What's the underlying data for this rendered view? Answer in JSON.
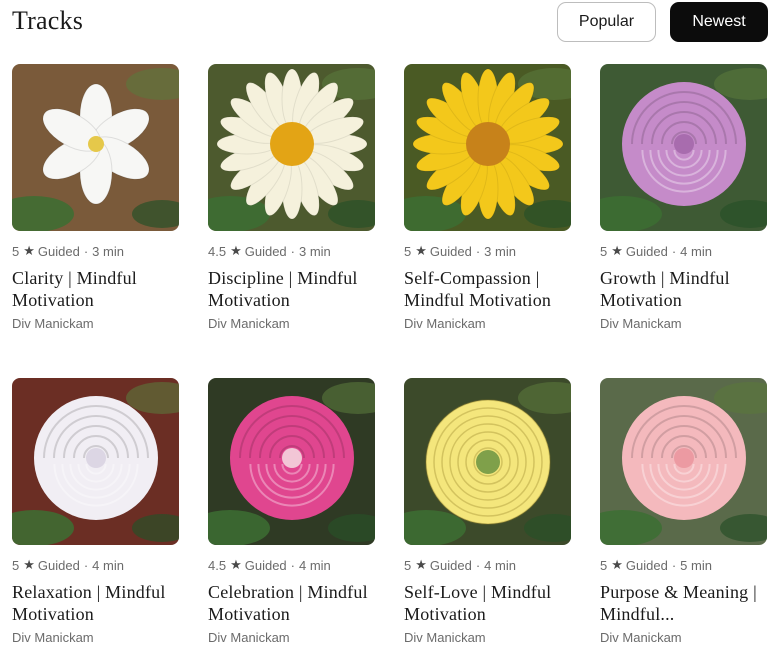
{
  "header": {
    "title": "Tracks",
    "sort_options": [
      {
        "label": "Popular",
        "selected": false
      },
      {
        "label": "Newest",
        "selected": true
      }
    ]
  },
  "tracks": [
    {
      "rating": "5",
      "type": "Guided",
      "duration": "3 min",
      "title": "Clarity | Mindful Motivation",
      "author": "Div Manickam",
      "flower": "white iris",
      "colors": {
        "bg": "#7a5a3a",
        "petal": "#f7f7f5",
        "center": "#e5c84a"
      }
    },
    {
      "rating": "4.5",
      "type": "Guided",
      "duration": "3 min",
      "title": "Discipline | Mindful Motivation",
      "author": "Div Manickam",
      "flower": "white daisy",
      "colors": {
        "bg": "#4d5a2e",
        "petal": "#f5f1dc",
        "center": "#e3a415"
      }
    },
    {
      "rating": "5",
      "type": "Guided",
      "duration": "3 min",
      "title": "Self-Compassion | Mindful Motivation",
      "author": "Div Manickam",
      "flower": "yellow daisy",
      "colors": {
        "bg": "#4a5a24",
        "petal": "#f3c81b",
        "center": "#c7821a"
      }
    },
    {
      "rating": "5",
      "type": "Guided",
      "duration": "4 min",
      "title": "Growth | Mindful Motivation",
      "author": "Div Manickam",
      "flower": "lavender rose",
      "colors": {
        "bg": "#3e5a34",
        "petal": "#c58bc9",
        "center": "#a86cae"
      }
    },
    {
      "rating": "5",
      "type": "Guided",
      "duration": "4 min",
      "title": "Relaxation | Mindful Motivation",
      "author": "Div Manickam",
      "flower": "white rose",
      "colors": {
        "bg": "#6b2e24",
        "petal": "#f1eef4",
        "center": "#dcd6e4"
      }
    },
    {
      "rating": "4.5",
      "type": "Guided",
      "duration": "4 min",
      "title": "Celebration | Mindful Motivation",
      "author": "Div Manickam",
      "flower": "pink rose",
      "colors": {
        "bg": "#2f3a24",
        "petal": "#e0468f",
        "center": "#f2c6d6"
      }
    },
    {
      "rating": "5",
      "type": "Guided",
      "duration": "4 min",
      "title": "Self-Love | Mindful Motivation",
      "author": "Div Manickam",
      "flower": "yellow ranunculus",
      "colors": {
        "bg": "#3c4a2a",
        "petal": "#f4e67c",
        "center": "#7fa04a"
      }
    },
    {
      "rating": "5",
      "type": "Guided",
      "duration": "5 min",
      "title": "Purpose & Meaning | Mindful...",
      "author": "Div Manickam",
      "flower": "peach rose",
      "colors": {
        "bg": "#5a6a4a",
        "petal": "#f4b9bd",
        "center": "#ec9aa2"
      }
    }
  ]
}
